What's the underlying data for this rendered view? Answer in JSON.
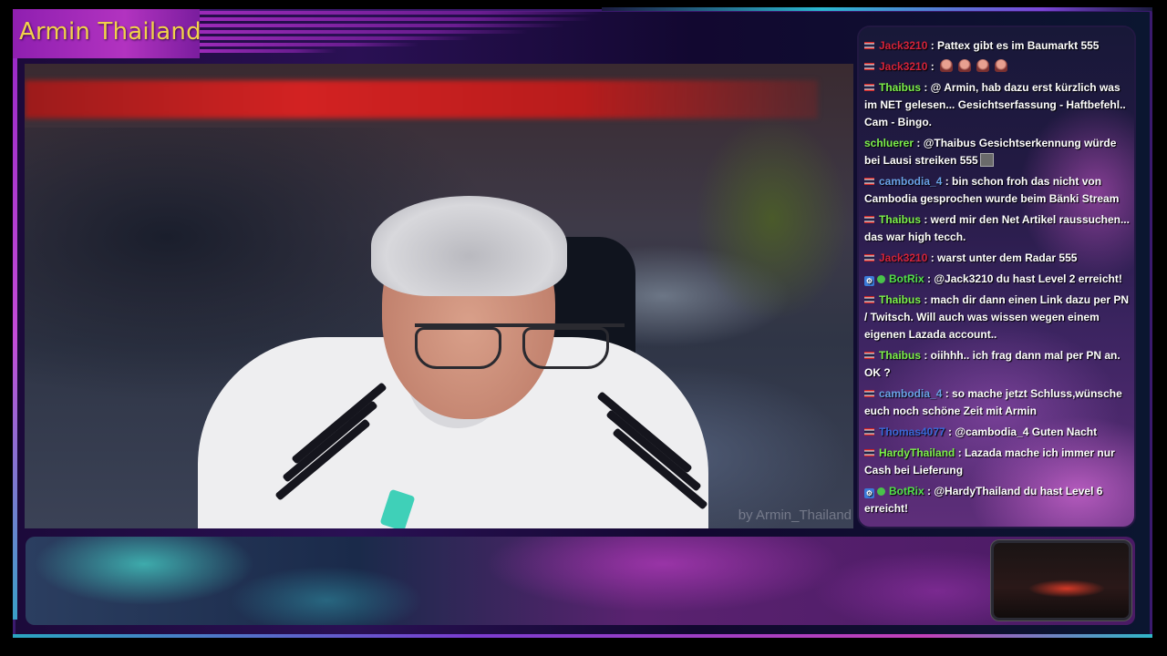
{
  "stream": {
    "title": "Armin Thailand",
    "watermark": "by Armin_Thailand"
  },
  "chat": {
    "messages": [
      {
        "user": "Jack3210",
        "text": ": Pattex gibt es im Baumarkt 555",
        "user_color": "#d4233a",
        "badge": "flag-thailand"
      },
      {
        "user": "Jack3210",
        "text": ":",
        "user_color": "#d4233a",
        "badge": "flag-thailand",
        "emotes": 4
      },
      {
        "user": "Thaibus",
        "text": ": @ Armin, hab dazu erst kürzlich was im NET gelesen... Gesichtserfassung - Haftbefehl.. Cam - Bingo.",
        "user_color": "#7cf04a",
        "badge": "flag-thailand"
      },
      {
        "user": "schluerer",
        "text": ": @Thaibus Gesichtserkennung würde bei Lausi streiken 555",
        "user_color": "#7cf04a",
        "badge": "none"
      },
      {
        "user": "cambodia_4",
        "text": ": bin schon froh das nicht von Cambodia gesprochen wurde beim Bänki Stream",
        "user_color": "#6aa2e6",
        "badge": "flag-thailand"
      },
      {
        "user": "Thaibus",
        "text": ": werd mir den Net Artikel raussuchen... das war high tecch.",
        "user_color": "#7cf04a",
        "badge": "flag-thailand"
      },
      {
        "user": "Jack3210",
        "text": ": warst unter dem Radar 555",
        "user_color": "#d4233a",
        "badge": "flag-thailand"
      },
      {
        "user": "BotRix",
        "text": ": @Jack3210 du hast Level 2 erreicht!",
        "user_color": "#53e04a",
        "badge": "bot"
      },
      {
        "user": "Thaibus",
        "text": ": mach dir dann einen Link dazu per PN / Twitsch. Will auch was wissen wegen einem eigenen Lazada account..",
        "user_color": "#7cf04a",
        "badge": "flag-thailand"
      },
      {
        "user": "Thaibus",
        "text": ": oiihhh.. ich frag dann mal per PN an. OK ?",
        "user_color": "#7cf04a",
        "badge": "flag-thailand"
      },
      {
        "user": "cambodia_4",
        "text": ": so mache jetzt Schluss,wünsche euch noch schöne Zeit mit Armin",
        "user_color": "#6aa2e6",
        "badge": "flag-thailand"
      },
      {
        "user": "Thomas4077",
        "text": ": @cambodia_4 Guten Nacht",
        "user_color": "#3a68d8",
        "badge": "flag-thailand"
      },
      {
        "user": "HardyThailand",
        "text": ": Lazada mache ich immer nur Cash bei Lieferung",
        "user_color": "#7cf04a",
        "badge": "flag-thailand"
      },
      {
        "user": "BotRix",
        "text": ": @HardyThailand du hast Level 6 erreicht!",
        "user_color": "#53e04a",
        "badge": "bot"
      }
    ]
  },
  "colors": {
    "title_text": "#f2d24a",
    "accent_purple": "#b233c0",
    "accent_teal": "#2ab8d0"
  }
}
